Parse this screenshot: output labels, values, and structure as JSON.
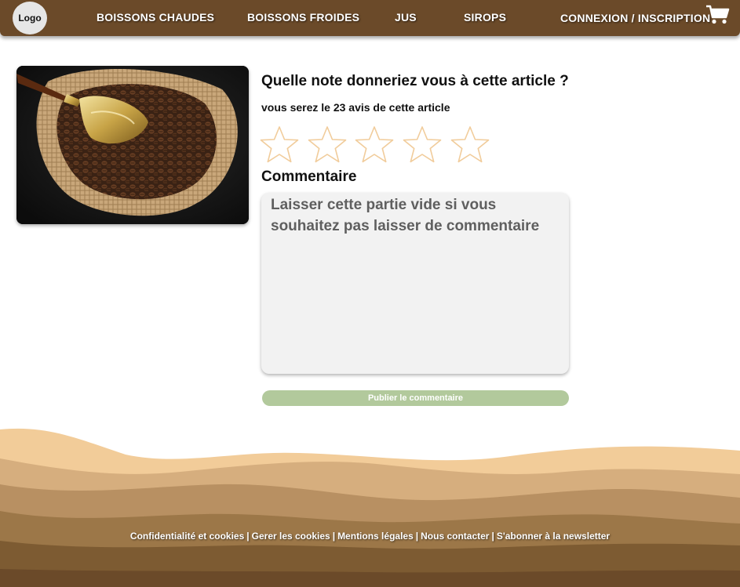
{
  "header": {
    "logo_label": "Logo",
    "nav_items": [
      "BOISSONS CHAUDES",
      "BOISSONS FROIDES",
      "JUS",
      "SIROPS"
    ],
    "account_link": "CONNEXION / INSCRIPTION",
    "cart_icon": "shopping-cart-icon"
  },
  "review": {
    "question": "Quelle note donneriez  vous à cette article ?",
    "count_text": "vous serez le 23 avis de cette article",
    "rating": {
      "max": 5,
      "value": 0,
      "star_icon": "star-outline-icon",
      "star_color": "#f1cc9b"
    },
    "comment_label": "Commentaire",
    "comment_placeholder": "Laisser cette partie vide si vous souhaitez pas laisser de commentaire",
    "comment_value": "",
    "publish_label": "Publier le commentaire"
  },
  "footer": {
    "links": [
      "Confidentialité et cookies",
      "Gerer les cookies",
      "Mentions légales",
      "Nous contacter",
      "S'abonner à la newsletter"
    ],
    "separator": "|"
  },
  "colors": {
    "header_bg": "#6b4a29",
    "button_green": "#b2c99c",
    "star_outline": "#f1cc9b",
    "textarea_bg": "#f2f2f2"
  }
}
